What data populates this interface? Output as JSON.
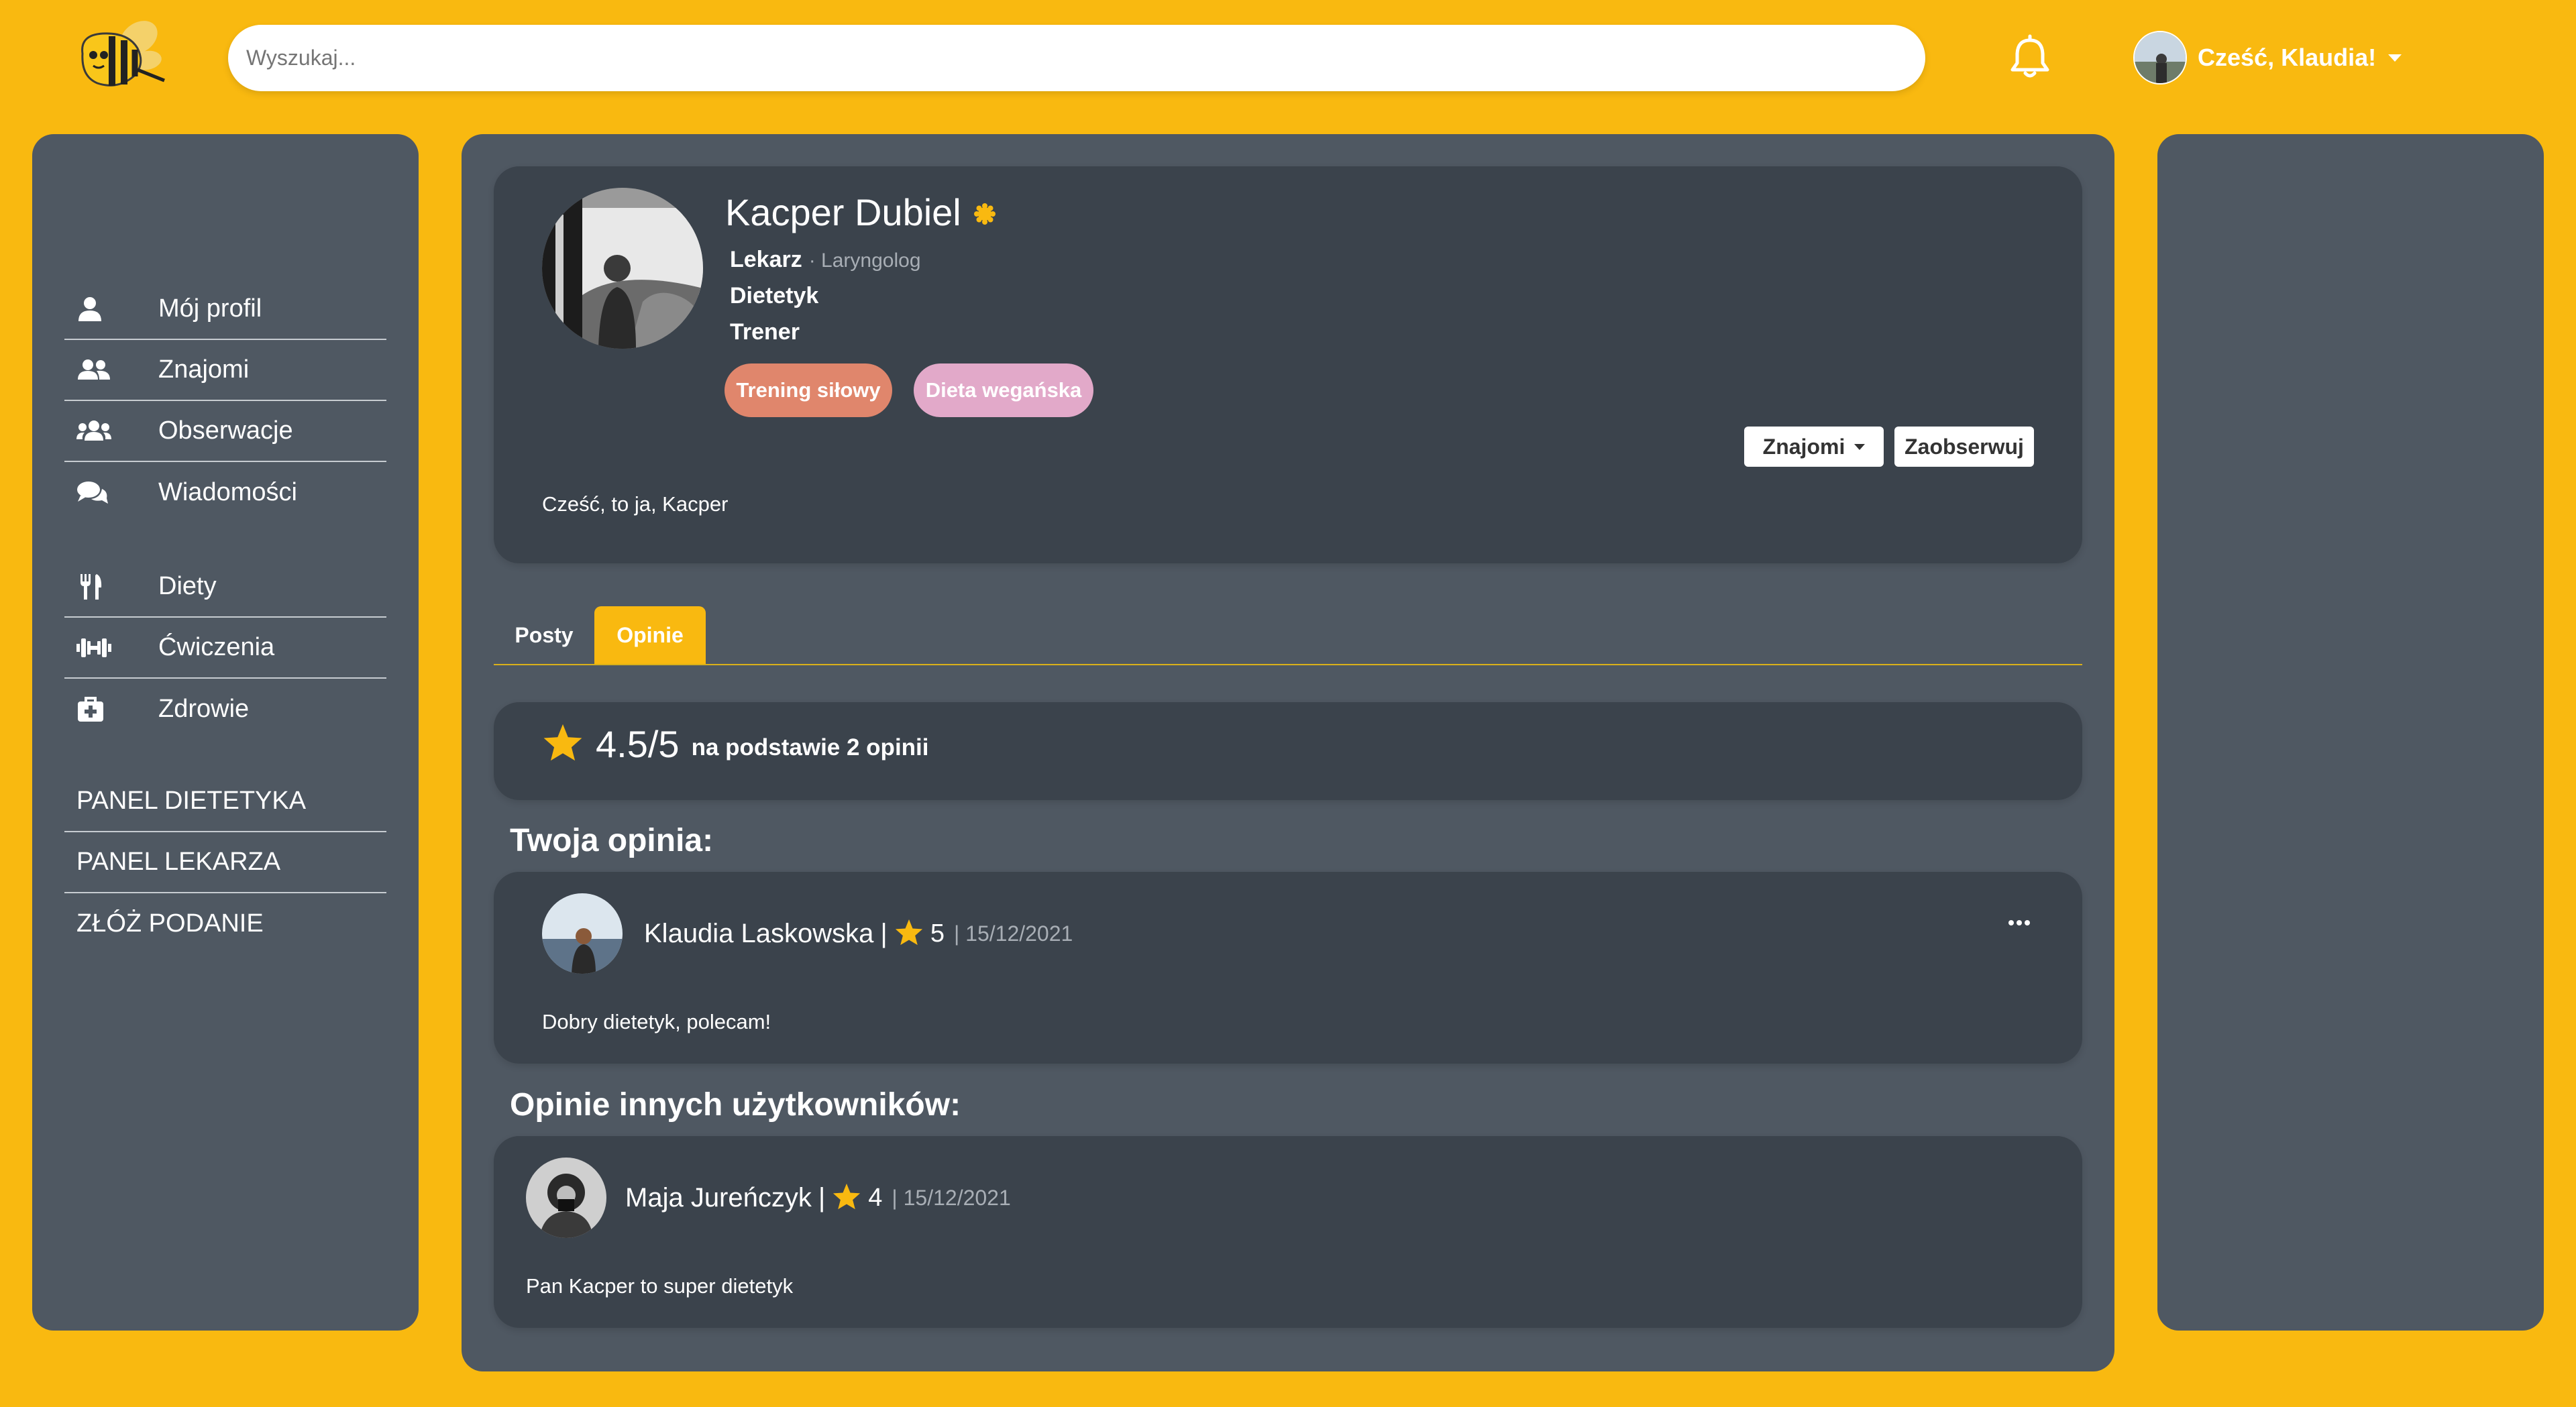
{
  "header": {
    "search_placeholder": "Wyszukaj...",
    "greeting": "Cześć, Klaudia!"
  },
  "sidebar": {
    "main_items": [
      {
        "label": "Mój profil",
        "icon": "user-icon"
      },
      {
        "label": "Znajomi",
        "icon": "user-friends-icon"
      },
      {
        "label": "Obserwacje",
        "icon": "users-icon"
      },
      {
        "label": "Wiadomości",
        "icon": "comments-icon"
      }
    ],
    "feature_items": [
      {
        "label": "Diety",
        "icon": "utensils-icon"
      },
      {
        "label": "Ćwiczenia",
        "icon": "dumbbell-icon"
      },
      {
        "label": "Zdrowie",
        "icon": "first-aid-icon"
      }
    ],
    "panel_items": [
      {
        "label": "PANEL DIETETYKA"
      },
      {
        "label": "PANEL LEKARZA"
      },
      {
        "label": "ZŁÓŻ PODANIE"
      }
    ]
  },
  "profile": {
    "name": "Kacper Dubiel",
    "roles": [
      {
        "label": "Lekarz",
        "sub": "· Laryngolog"
      },
      {
        "label": "Dietetyk"
      },
      {
        "label": "Trener"
      }
    ],
    "tags": [
      {
        "label": "Trening siłowy",
        "color": "#E0866C"
      },
      {
        "label": "Dieta wegańska",
        "color": "#E2A9C9"
      }
    ],
    "friends_button": "Znajomi",
    "follow_button": "Zaobserwuj",
    "bio": "Cześć, to ja, Kacper"
  },
  "tabs": [
    {
      "label": "Posty",
      "active": false
    },
    {
      "label": "Opinie",
      "active": true
    }
  ],
  "rating": {
    "value": "4.5/5",
    "text": "na podstawie 2 opinii"
  },
  "own_opinion": {
    "title": "Twoja opinia:",
    "author": "Klaudia Laskowska",
    "score": "5",
    "date": "| 15/12/2021",
    "text": "Dobry dietetyk, polecam!"
  },
  "other_opinions": {
    "title": "Opinie innych użytkowników:",
    "items": [
      {
        "author": "Maja Jureńczyk",
        "score": "4",
        "date": "| 15/12/2021",
        "text": "Pan Kacper to super dietetyk"
      }
    ]
  },
  "colors": {
    "accent": "#F9B910",
    "panel": "#4F5862",
    "card": "#3B434C"
  }
}
